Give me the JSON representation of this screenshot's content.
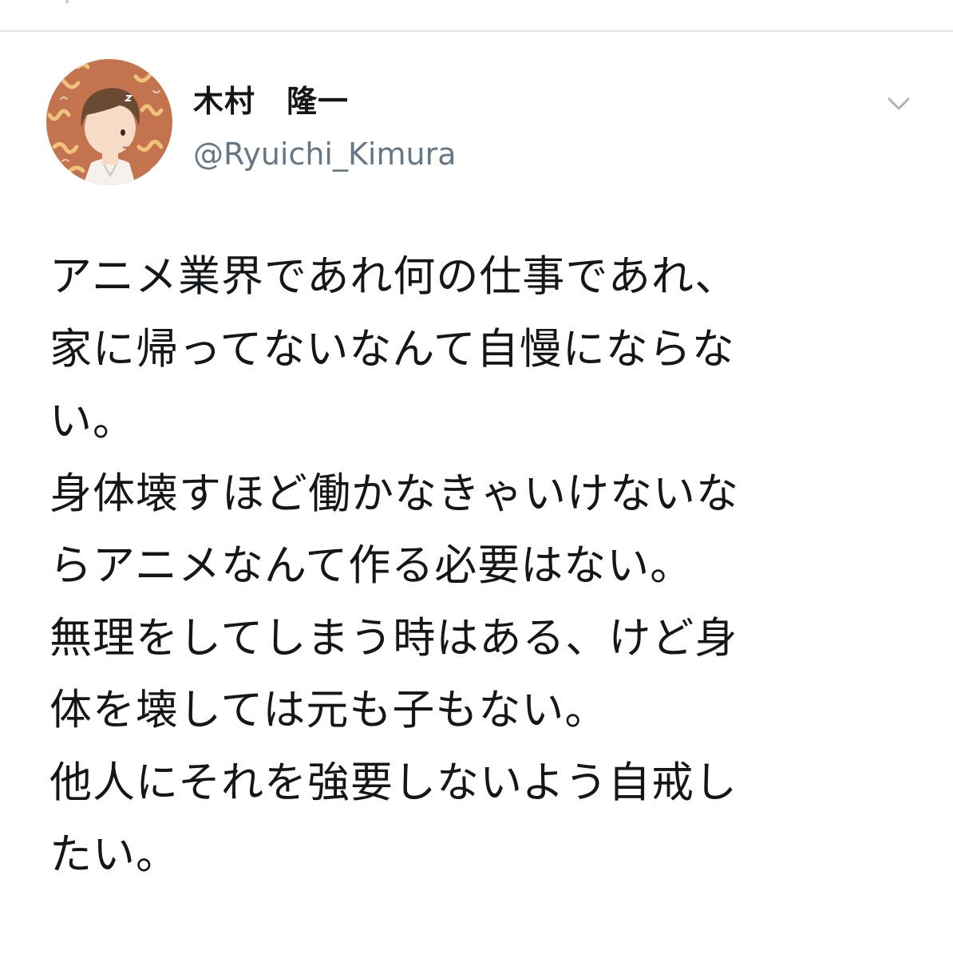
{
  "tweet": {
    "author": {
      "display_name": "木村　隆一",
      "handle": "@Ryuichi_Kimura",
      "avatar_icon": "user-avatar-illustration"
    },
    "menu_icon": "chevron-down-icon",
    "text_lines": [
      "アニメ業界であれ何の仕事であれ、",
      "家に帰ってないなんて自慢にならな",
      "い。",
      "身体壊すほど働かなきゃいけないな",
      "らアニメなんて作る必要はない。",
      "無理をしてしまう時はある、けど身",
      "体を壊しては元も子もない。",
      "他人にそれを強要しないよう自戒し",
      "たい。"
    ]
  },
  "colors": {
    "text": "#14171a",
    "handle": "#657786",
    "divider": "#e1e8ed",
    "caret": "#aab8c2",
    "avatar_background": "#c4734f"
  }
}
